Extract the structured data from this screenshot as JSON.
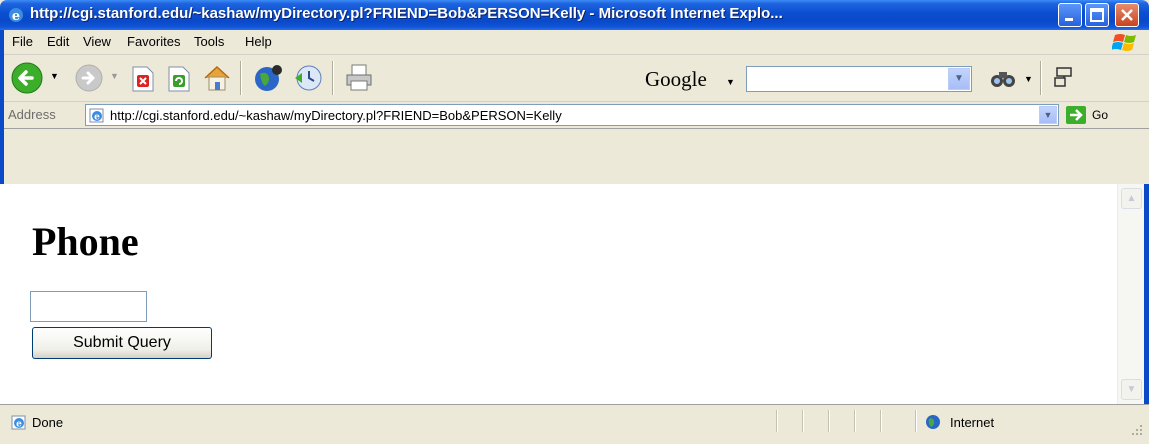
{
  "window": {
    "title": "http://cgi.stanford.edu/~kashaw/myDirectory.pl?FRIEND=Bob&PERSON=Kelly - Microsoft Internet Explo..."
  },
  "menu": {
    "items": [
      "File",
      "Edit",
      "View",
      "Favorites",
      "Tools",
      "Help"
    ]
  },
  "toolbar": {
    "icons": [
      "back-icon",
      "forward-icon",
      "stop-icon",
      "refresh-icon",
      "home-icon",
      "msn-icon",
      "history-icon",
      "print-icon"
    ],
    "google_label": "Google",
    "google_search_value": ""
  },
  "address": {
    "label": "Address",
    "url": "http://cgi.stanford.edu/~kashaw/myDirectory.pl?FRIEND=Bob&PERSON=Kelly",
    "go_label": "Go"
  },
  "page": {
    "heading": "Phone",
    "phone_value": "",
    "submit_label": "Submit Query"
  },
  "status": {
    "text": "Done",
    "zone": "Internet"
  },
  "colors": {
    "titlebar": "#0A49C8",
    "chrome": "#ECE9D8",
    "close_button": "#C8441F"
  }
}
